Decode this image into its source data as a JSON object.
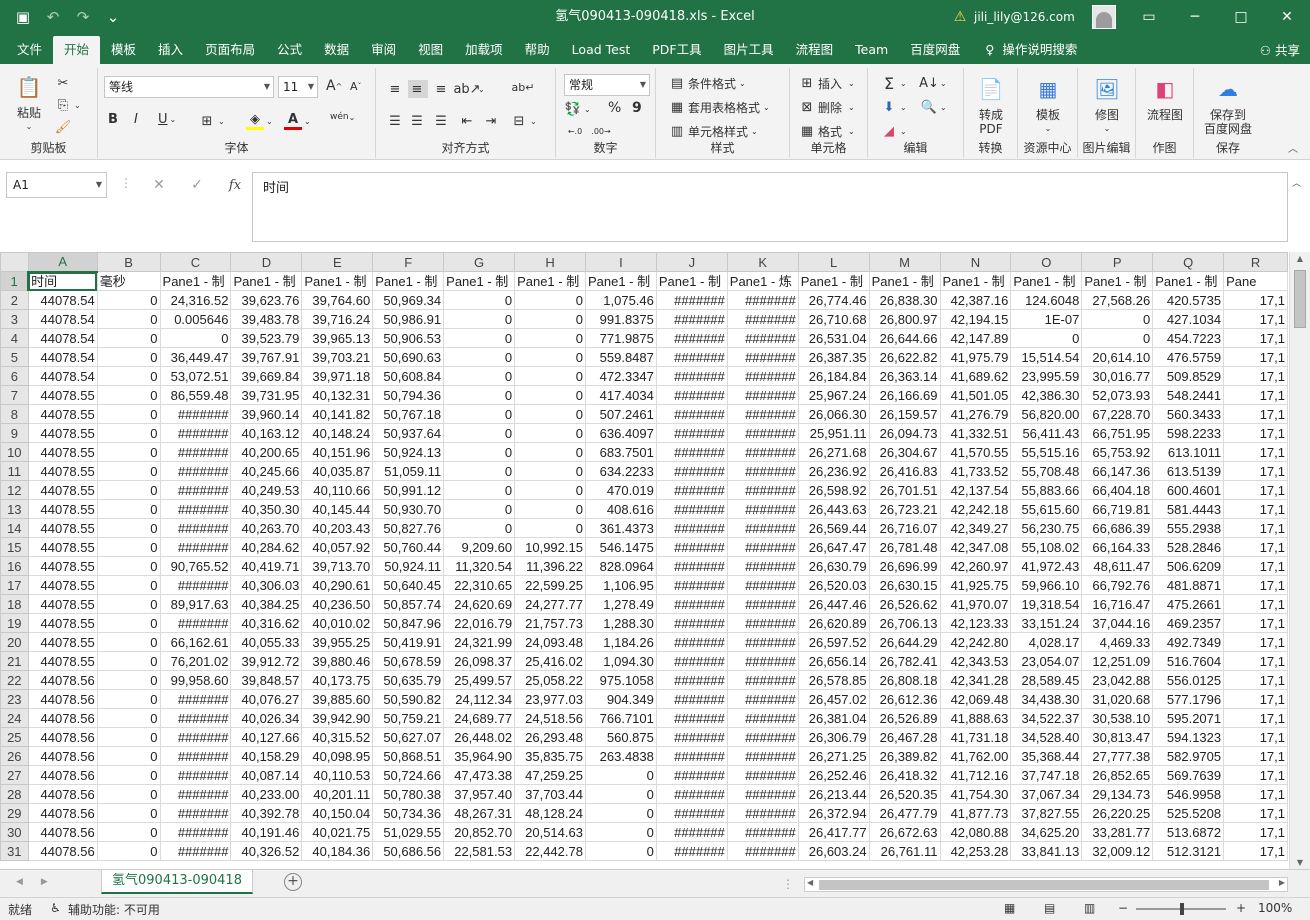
{
  "titlebar": {
    "title": "氢气090413-090418.xls  -  Excel",
    "user": "jili_lily@126.com",
    "qat_save": "save-icon",
    "minimize": "─",
    "restore": "□",
    "close": "✕"
  },
  "menus": [
    "文件",
    "开始",
    "模板",
    "插入",
    "页面布局",
    "公式",
    "数据",
    "审阅",
    "视图",
    "加载项",
    "帮助",
    "Load Test",
    "PDF工具",
    "图片工具",
    "流程图",
    "Team",
    "百度网盘"
  ],
  "menu_search": "操作说明搜索",
  "share": "共享",
  "ribbon": {
    "clipboard": {
      "paste": "粘贴",
      "label": "剪贴板"
    },
    "font": {
      "name": "等线",
      "size": "11",
      "label": "字体",
      "bold": "B",
      "italic": "I",
      "underline": "U",
      "grow": "A",
      "shrink": "A",
      "phonetic": "wén"
    },
    "align": {
      "label": "对齐方式"
    },
    "number": {
      "format": "常规",
      "label": "数字",
      "percent": "%",
      "comma": "9"
    },
    "styles": {
      "cond": "条件格式",
      "table": "套用表格格式",
      "cell": "单元格样式",
      "label": "样式"
    },
    "cells": {
      "insert": "插入",
      "delete": "删除",
      "format": "格式",
      "label": "单元格"
    },
    "editing": {
      "label": "编辑"
    },
    "convert": {
      "btn1": "转成",
      "btn2": "PDF",
      "label": "转换"
    },
    "resource": {
      "btn": "模板",
      "label": "资源中心"
    },
    "picedit": {
      "btn": "修图",
      "label": "图片编辑"
    },
    "draw": {
      "btn": "流程图",
      "label": "作图"
    },
    "save": {
      "btn1": "保存到",
      "btn2": "百度网盘",
      "label": "保存"
    }
  },
  "formula_bar": {
    "name_box": "A1",
    "cancel": "✕",
    "enter": "✓",
    "fx": "fx",
    "content": "时间"
  },
  "columns": [
    "A",
    "B",
    "C",
    "D",
    "E",
    "F",
    "G",
    "H",
    "I",
    "J",
    "K",
    "L",
    "M",
    "N",
    "O",
    "P",
    "Q",
    "R"
  ],
  "header_row": [
    "时间",
    "毫秒",
    "Pane1 - 制",
    "Pane1 - 制",
    "Pane1 - 制",
    "Pane1 - 制",
    "Pane1 - 制",
    "Pane1 - 制",
    "Pane1 - 制",
    "Pane1 - 制",
    "Pane1 - 炼",
    "Pane1 - 制",
    "Pane1 - 制",
    "Pane1 - 制",
    "Pane1 - 制",
    "Pane1 - 制",
    "Pane1 - 制",
    "Pane"
  ],
  "rows": [
    [
      "44078.54",
      "0",
      "24,316.52",
      "39,623.76",
      "39,764.60",
      "50,969.34",
      "0",
      "0",
      "1,075.46",
      "#######",
      "#######",
      "26,774.46",
      "26,838.30",
      "42,387.16",
      "124.6048",
      "27,568.26",
      "420.5735",
      "17,1"
    ],
    [
      "44078.54",
      "0",
      "0.005646",
      "39,483.78",
      "39,716.24",
      "50,986.91",
      "0",
      "0",
      "991.8375",
      "#######",
      "#######",
      "26,710.68",
      "26,800.97",
      "42,194.15",
      "1E-07",
      "0",
      "427.1034",
      "17,1"
    ],
    [
      "44078.54",
      "0",
      "0",
      "39,523.79",
      "39,965.13",
      "50,906.53",
      "0",
      "0",
      "771.9875",
      "#######",
      "#######",
      "26,531.04",
      "26,644.66",
      "42,147.89",
      "0",
      "0",
      "454.7223",
      "17,1"
    ],
    [
      "44078.54",
      "0",
      "36,449.47",
      "39,767.91",
      "39,703.21",
      "50,690.63",
      "0",
      "0",
      "559.8487",
      "#######",
      "#######",
      "26,387.35",
      "26,622.82",
      "41,975.79",
      "15,514.54",
      "20,614.10",
      "476.5759",
      "17,1"
    ],
    [
      "44078.54",
      "0",
      "53,072.51",
      "39,669.84",
      "39,971.18",
      "50,608.84",
      "0",
      "0",
      "472.3347",
      "#######",
      "#######",
      "26,184.84",
      "26,363.14",
      "41,689.62",
      "23,995.59",
      "30,016.77",
      "509.8529",
      "17,1"
    ],
    [
      "44078.55",
      "0",
      "86,559.48",
      "39,731.95",
      "40,132.31",
      "50,794.36",
      "0",
      "0",
      "417.4034",
      "#######",
      "#######",
      "25,967.24",
      "26,166.69",
      "41,501.05",
      "42,386.30",
      "52,073.93",
      "548.2441",
      "17,1"
    ],
    [
      "44078.55",
      "0",
      "#######",
      "39,960.14",
      "40,141.82",
      "50,767.18",
      "0",
      "0",
      "507.2461",
      "#######",
      "#######",
      "26,066.30",
      "26,159.57",
      "41,276.79",
      "56,820.00",
      "67,228.70",
      "560.3433",
      "17,1"
    ],
    [
      "44078.55",
      "0",
      "#######",
      "40,163.12",
      "40,148.24",
      "50,937.64",
      "0",
      "0",
      "636.4097",
      "#######",
      "#######",
      "25,951.11",
      "26,094.73",
      "41,332.51",
      "56,411.43",
      "66,751.95",
      "598.2233",
      "17,1"
    ],
    [
      "44078.55",
      "0",
      "#######",
      "40,200.65",
      "40,151.96",
      "50,924.13",
      "0",
      "0",
      "683.7501",
      "#######",
      "#######",
      "26,271.68",
      "26,304.67",
      "41,570.55",
      "55,515.16",
      "65,753.92",
      "613.1011",
      "17,1"
    ],
    [
      "44078.55",
      "0",
      "#######",
      "40,245.66",
      "40,035.87",
      "51,059.11",
      "0",
      "0",
      "634.2233",
      "#######",
      "#######",
      "26,236.92",
      "26,416.83",
      "41,733.52",
      "55,708.48",
      "66,147.36",
      "613.5139",
      "17,1"
    ],
    [
      "44078.55",
      "0",
      "#######",
      "40,249.53",
      "40,110.66",
      "50,991.12",
      "0",
      "0",
      "470.019",
      "#######",
      "#######",
      "26,598.92",
      "26,701.51",
      "42,137.54",
      "55,883.66",
      "66,404.18",
      "600.4601",
      "17,1"
    ],
    [
      "44078.55",
      "0",
      "#######",
      "40,350.30",
      "40,145.44",
      "50,930.70",
      "0",
      "0",
      "408.616",
      "#######",
      "#######",
      "26,443.63",
      "26,723.21",
      "42,242.18",
      "55,615.60",
      "66,719.81",
      "581.4443",
      "17,1"
    ],
    [
      "44078.55",
      "0",
      "#######",
      "40,263.70",
      "40,203.43",
      "50,827.76",
      "0",
      "0",
      "361.4373",
      "#######",
      "#######",
      "26,569.44",
      "26,716.07",
      "42,349.27",
      "56,230.75",
      "66,686.39",
      "555.2938",
      "17,1"
    ],
    [
      "44078.55",
      "0",
      "#######",
      "40,284.62",
      "40,057.92",
      "50,760.44",
      "9,209.60",
      "10,992.15",
      "546.1475",
      "#######",
      "#######",
      "26,647.47",
      "26,781.48",
      "42,347.08",
      "55,108.02",
      "66,164.33",
      "528.2846",
      "17,1"
    ],
    [
      "44078.55",
      "0",
      "90,765.52",
      "40,419.71",
      "39,713.70",
      "50,924.11",
      "11,320.54",
      "11,396.22",
      "828.0964",
      "#######",
      "#######",
      "26,630.79",
      "26,696.99",
      "42,260.97",
      "41,972.43",
      "48,611.47",
      "506.6209",
      "17,1"
    ],
    [
      "44078.55",
      "0",
      "#######",
      "40,306.03",
      "40,290.61",
      "50,640.45",
      "22,310.65",
      "22,599.25",
      "1,106.95",
      "#######",
      "#######",
      "26,520.03",
      "26,630.15",
      "41,925.75",
      "59,966.10",
      "66,792.76",
      "481.8871",
      "17,1"
    ],
    [
      "44078.55",
      "0",
      "89,917.63",
      "40,384.25",
      "40,236.50",
      "50,857.74",
      "24,620.69",
      "24,277.77",
      "1,278.49",
      "#######",
      "#######",
      "26,447.46",
      "26,526.62",
      "41,970.07",
      "19,318.54",
      "16,716.47",
      "475.2661",
      "17,1"
    ],
    [
      "44078.55",
      "0",
      "#######",
      "40,316.62",
      "40,010.02",
      "50,847.96",
      "22,016.79",
      "21,757.73",
      "1,288.30",
      "#######",
      "#######",
      "26,620.89",
      "26,706.13",
      "42,123.33",
      "33,151.24",
      "37,044.16",
      "469.2357",
      "17,1"
    ],
    [
      "44078.55",
      "0",
      "66,162.61",
      "40,055.33",
      "39,955.25",
      "50,419.91",
      "24,321.99",
      "24,093.48",
      "1,184.26",
      "#######",
      "#######",
      "26,597.52",
      "26,644.29",
      "42,242.80",
      "4,028.17",
      "4,469.33",
      "492.7349",
      "17,1"
    ],
    [
      "44078.55",
      "0",
      "76,201.02",
      "39,912.72",
      "39,880.46",
      "50,678.59",
      "26,098.37",
      "25,416.02",
      "1,094.30",
      "#######",
      "#######",
      "26,656.14",
      "26,782.41",
      "42,343.53",
      "23,054.07",
      "12,251.09",
      "516.7604",
      "17,1"
    ],
    [
      "44078.56",
      "0",
      "99,958.60",
      "39,848.57",
      "40,173.75",
      "50,635.79",
      "25,499.57",
      "25,058.22",
      "975.1058",
      "#######",
      "#######",
      "26,578.85",
      "26,808.18",
      "42,341.28",
      "28,589.45",
      "23,042.88",
      "556.0125",
      "17,1"
    ],
    [
      "44078.56",
      "0",
      "#######",
      "40,076.27",
      "39,885.60",
      "50,590.82",
      "24,112.34",
      "23,977.03",
      "904.349",
      "#######",
      "#######",
      "26,457.02",
      "26,612.36",
      "42,069.48",
      "34,438.30",
      "31,020.68",
      "577.1796",
      "17,1"
    ],
    [
      "44078.56",
      "0",
      "#######",
      "40,026.34",
      "39,942.90",
      "50,759.21",
      "24,689.77",
      "24,518.56",
      "766.7101",
      "#######",
      "#######",
      "26,381.04",
      "26,526.89",
      "41,888.63",
      "34,522.37",
      "30,538.10",
      "595.2071",
      "17,1"
    ],
    [
      "44078.56",
      "0",
      "#######",
      "40,127.66",
      "40,315.52",
      "50,627.07",
      "26,448.02",
      "26,293.48",
      "560.875",
      "#######",
      "#######",
      "26,306.79",
      "26,467.28",
      "41,731.18",
      "34,528.40",
      "30,813.47",
      "594.1323",
      "17,1"
    ],
    [
      "44078.56",
      "0",
      "#######",
      "40,158.29",
      "40,098.95",
      "50,868.51",
      "35,964.90",
      "35,835.75",
      "263.4838",
      "#######",
      "#######",
      "26,271.25",
      "26,389.82",
      "41,762.00",
      "35,368.44",
      "27,777.38",
      "582.9705",
      "17,1"
    ],
    [
      "44078.56",
      "0",
      "#######",
      "40,087.14",
      "40,110.53",
      "50,724.66",
      "47,473.38",
      "47,259.25",
      "0",
      "#######",
      "#######",
      "26,252.46",
      "26,418.32",
      "41,712.16",
      "37,747.18",
      "26,852.65",
      "569.7639",
      "17,1"
    ],
    [
      "44078.56",
      "0",
      "#######",
      "40,233.00",
      "40,201.11",
      "50,780.38",
      "37,957.40",
      "37,703.44",
      "0",
      "#######",
      "#######",
      "26,213.44",
      "26,520.35",
      "41,754.30",
      "37,067.34",
      "29,134.73",
      "546.9958",
      "17,1"
    ],
    [
      "44078.56",
      "0",
      "#######",
      "40,392.78",
      "40,150.04",
      "50,734.36",
      "48,267.31",
      "48,128.24",
      "0",
      "#######",
      "#######",
      "26,372.94",
      "26,477.79",
      "41,877.73",
      "37,827.55",
      "26,220.25",
      "525.5208",
      "17,1"
    ],
    [
      "44078.56",
      "0",
      "#######",
      "40,191.46",
      "40,021.75",
      "51,029.55",
      "20,852.70",
      "20,514.63",
      "0",
      "#######",
      "#######",
      "26,417.77",
      "26,672.63",
      "42,080.88",
      "34,625.20",
      "33,281.77",
      "513.6872",
      "17,1"
    ],
    [
      "44078.56",
      "0",
      "#######",
      "40,326.52",
      "40,184.36",
      "50,686.56",
      "22,581.53",
      "22,442.78",
      "0",
      "#######",
      "#######",
      "26,603.24",
      "26,761.11",
      "42,253.28",
      "33,841.13",
      "32,009.12",
      "512.3121",
      "17,1"
    ]
  ],
  "sheet_tab": "氢气090413-090418",
  "status": {
    "ready": "就绪",
    "accessibility": "辅助功能: 不可用",
    "zoom": "100%"
  }
}
